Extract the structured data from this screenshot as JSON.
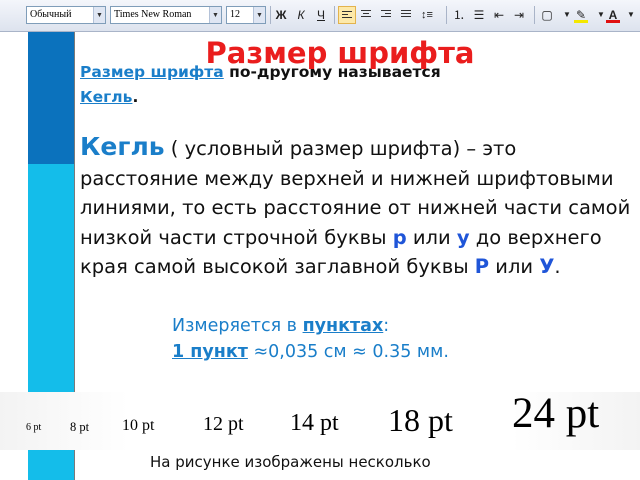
{
  "toolbar": {
    "style_value": "Обычный",
    "font_value": "Times New Roman",
    "size_value": "12",
    "bold": "Ж",
    "italic": "К",
    "underline": "Ч",
    "highlight_color": "#f4e800",
    "font_color": "#e01010"
  },
  "slide": {
    "title": "Размер шрифта",
    "para1": {
      "term1": "Размер шрифта",
      "middle": " по-другому называется ",
      "term2": "Кегль",
      "end": "."
    },
    "para2": {
      "term": "Кегль",
      "text1": " ( условный размер шрифта) – это расстояние между верхней и нижней шрифтовыми линиями, то есть расстояние от нижней части самой низкой части строчной буквы ",
      "letter1": "р",
      "or1": " или ",
      "letter2": "у",
      "text2": " до верхнего края самой высокой заглавной буквы ",
      "letter3": "Р",
      "or2": " или ",
      "letter4": "У",
      "end": "."
    },
    "measure": {
      "prefix": "Измеряется в ",
      "unit": "пунктах",
      "colon": ":",
      "one_point": "1 пункт",
      "equiv": " ≈0,035 см ≈ 0.35 мм."
    },
    "samples": [
      "6 pt",
      "8 pt",
      "10 pt",
      "12 pt",
      "14 pt",
      "18 pt",
      "24 pt"
    ],
    "caption": "На рисунке изображены несколько"
  }
}
